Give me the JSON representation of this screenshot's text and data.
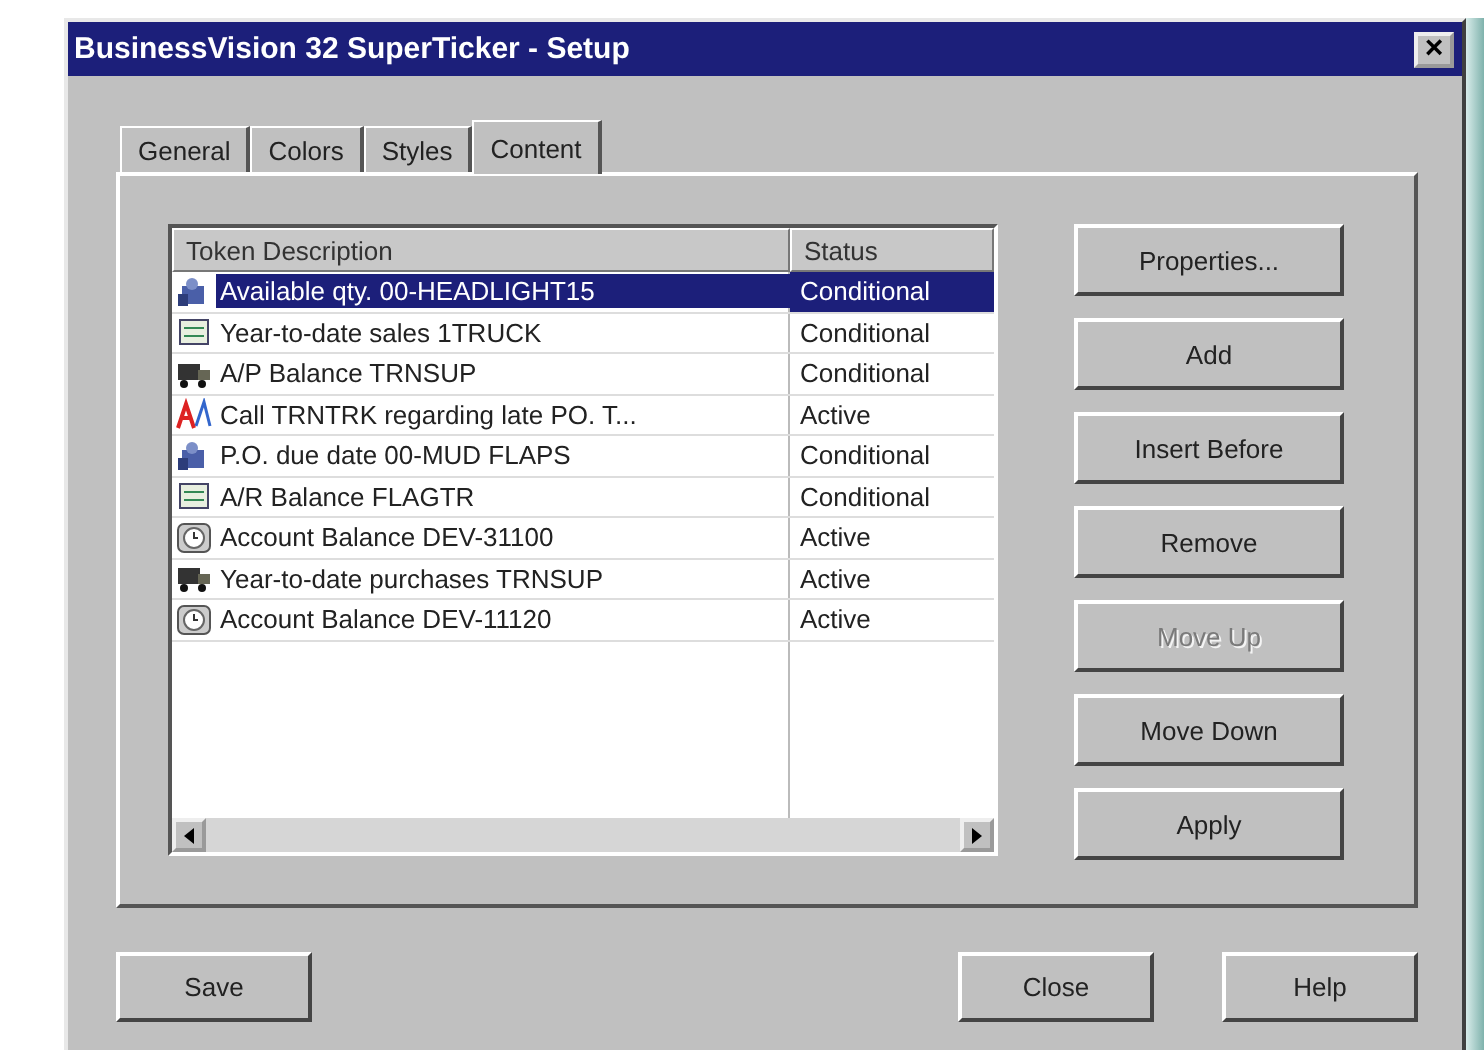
{
  "window": {
    "title": "BusinessVision 32 SuperTicker - Setup",
    "close": "×"
  },
  "tabs": [
    {
      "label": "General",
      "selected": false
    },
    {
      "label": "Colors",
      "selected": false
    },
    {
      "label": "Styles",
      "selected": false
    },
    {
      "label": "Content",
      "selected": true
    }
  ],
  "table": {
    "columns": [
      "Token Description",
      "Status"
    ],
    "rows": [
      {
        "description": "Available qty. 00-HEADLIGHT15",
        "status": "Conditional",
        "selected": true
      },
      {
        "description": "Year-to-date sales 1TRUCK",
        "status": "Conditional",
        "selected": false
      },
      {
        "description": "A/P Balance TRNSUP",
        "status": "Conditional",
        "selected": false
      },
      {
        "description": "Call TRNTRK regarding late PO.  T...",
        "status": "Active",
        "selected": false
      },
      {
        "description": "P.O. due date 00-MUD FLAPS",
        "status": "Conditional",
        "selected": false
      },
      {
        "description": "A/R Balance FLAGTR",
        "status": "Conditional",
        "selected": false
      },
      {
        "description": "Account Balance DEV-31100",
        "status": "Active",
        "selected": false
      },
      {
        "description": "Year-to-date purchases TRNSUP",
        "status": "Active",
        "selected": false
      },
      {
        "description": "Account Balance DEV-11120",
        "status": "Active",
        "selected": false
      }
    ]
  },
  "side_buttons": [
    {
      "label": "Properties...",
      "disabled": false
    },
    {
      "label": "Add",
      "disabled": false
    },
    {
      "label": "Insert Before",
      "disabled": false
    },
    {
      "label": "Remove",
      "disabled": false
    },
    {
      "label": "Move Up",
      "disabled": true
    },
    {
      "label": "Move Down",
      "disabled": false
    },
    {
      "label": "Apply",
      "disabled": false
    }
  ],
  "bottom_buttons": {
    "left": [
      "Save"
    ],
    "right": [
      "Close",
      "Help"
    ]
  }
}
